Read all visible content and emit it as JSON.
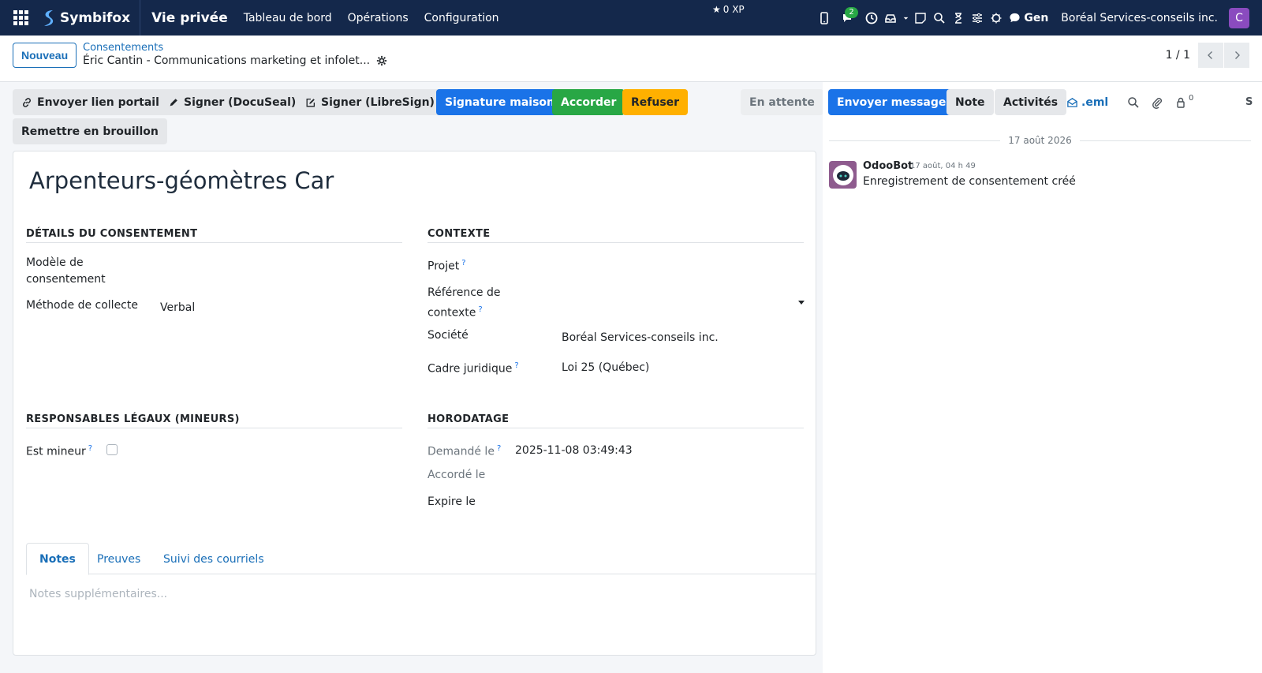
{
  "topbar": {
    "brand": "Symbifox",
    "module": "Vie privée",
    "menu": [
      "Tableau de bord",
      "Opérations",
      "Configuration"
    ],
    "xp": "0 XP",
    "messages_badge": "2",
    "gen_label": "Gen",
    "company": "Boréal Services-conseils inc.",
    "avatar_letter": "C"
  },
  "breadcrumb": {
    "new_button": "Nouveau",
    "parent": "Consentements",
    "current": "Éric Cantin - Communications marketing et infolet..."
  },
  "pager": {
    "value": "1 / 1"
  },
  "actions": {
    "send_portal": "Envoyer lien portail",
    "sign_docuseal": "Signer (DocuSeal)",
    "sign_libresign": "Signer (LibreSign)",
    "sign_home": "Signature maison",
    "grant": "Accorder",
    "refuse": "Refuser",
    "state": "En attente",
    "reset_draft": "Remettre en brouillon"
  },
  "form": {
    "title": "Arpenteurs-géomètres Car",
    "details": {
      "heading": "DÉTAILS DU CONSENTEMENT",
      "template_label_1": "Modèle de",
      "template_label_2": "consentement",
      "method_label": "Méthode de collecte",
      "method_value": "Verbal"
    },
    "context": {
      "heading": "CONTEXTE",
      "project_label": "Projet",
      "reference_label_1": "Référence de",
      "reference_label_2": "contexte",
      "company_label": "Société",
      "company_value": "Boréal Services-conseils inc.",
      "legal_label": "Cadre juridique",
      "legal_value": "Loi 25 (Québec)"
    },
    "guardians": {
      "heading": "RESPONSABLES LÉGAUX (MINEURS)",
      "minor_label": "Est mineur",
      "is_minor": false
    },
    "timestamps": {
      "heading": "HORODATAGE",
      "requested_label": "Demandé le",
      "requested_value": "2025-11-08 03:49:43",
      "granted_label": "Accordé le",
      "expires_label": "Expire le"
    },
    "tabs": [
      "Notes",
      "Preuves",
      "Suivi des courriels"
    ],
    "active_tab": "Notes",
    "notes_placeholder": "Notes supplémentaires..."
  },
  "chatter": {
    "send_message": "Envoyer message",
    "note": "Note",
    "activities": "Activités",
    "eml": ".eml",
    "followers_count": "0",
    "truncated_label": "S",
    "date_separator": "17 août 2026",
    "message": {
      "author": "OdooBot",
      "date": "17 août, 04 h 49",
      "body": "Enregistrement de consentement créé"
    }
  },
  "colors": {
    "navbar": "#14284b",
    "primary": "#1a73e8",
    "success": "#28a745",
    "warning": "#ffb000",
    "link": "#1a6fb8"
  }
}
